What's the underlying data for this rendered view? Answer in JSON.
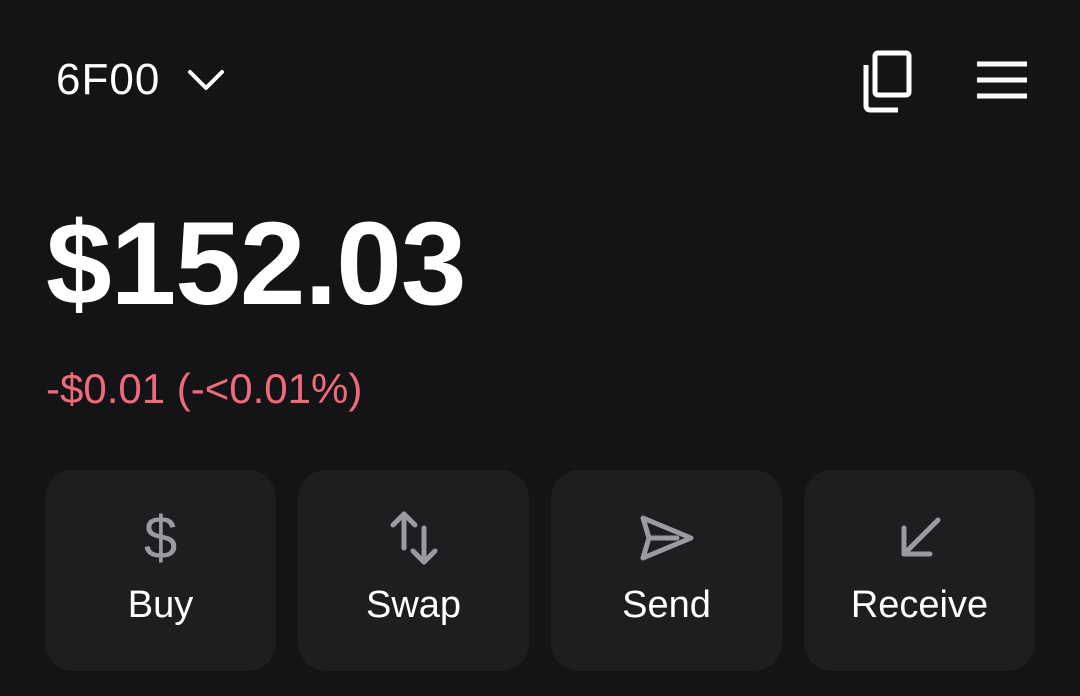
{
  "header": {
    "account_name": "6F00",
    "icons": {
      "chevron": "chevron-down-icon",
      "copy": "copy-icon",
      "menu": "hamburger-menu-icon"
    }
  },
  "balance": {
    "amount": "$152.03",
    "change": "-$0.01 (-<0.01%)"
  },
  "colors": {
    "background": "#141416",
    "card": "#1e1e21",
    "negative": "#ef6b7b",
    "icon_muted": "#9b9b9f"
  },
  "actions": [
    {
      "label": "Buy",
      "icon": "dollar-icon",
      "glyph": "$"
    },
    {
      "label": "Swap",
      "icon": "swap-arrows-icon"
    },
    {
      "label": "Send",
      "icon": "send-icon"
    },
    {
      "label": "Receive",
      "icon": "receive-arrow-icon"
    }
  ]
}
